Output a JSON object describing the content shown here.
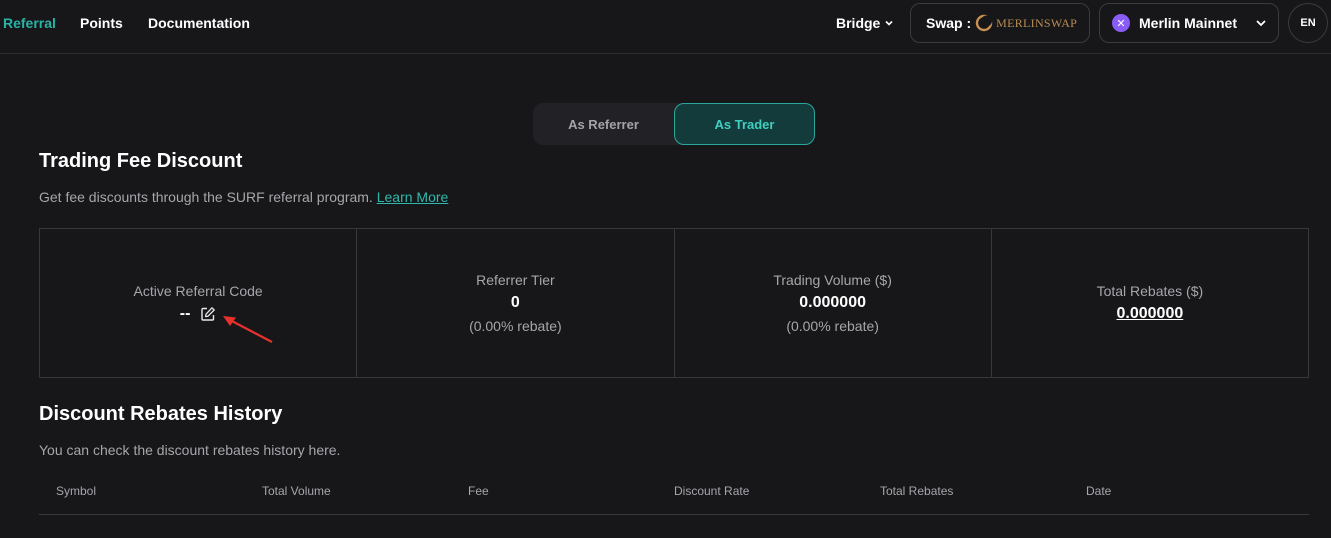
{
  "nav": {
    "links": [
      "Referral",
      "Points",
      "Documentation"
    ],
    "bridge_label": "Bridge",
    "swap_label": "Swap :",
    "swap_brand": "MERLINSWAP",
    "network_label": "Merlin Mainnet",
    "language": "EN"
  },
  "toggle": {
    "referrer": "As Referrer",
    "trader": "As Trader",
    "active": "As Trader"
  },
  "fee_section": {
    "title": "Trading Fee Discount",
    "description": "Get fee discounts through the SURF referral program.",
    "learn_more": "Learn More"
  },
  "stats": {
    "active_code": {
      "label": "Active Referral Code",
      "value": "--"
    },
    "tier": {
      "label": "Referrer Tier",
      "value": "0",
      "sub": "(0.00% rebate)"
    },
    "volume": {
      "label": "Trading Volume ($)",
      "value": "0.000000",
      "sub": "(0.00% rebate)"
    },
    "rebates": {
      "label": "Total Rebates ($)",
      "value": "0.000000"
    }
  },
  "history_section": {
    "title": "Discount Rebates History",
    "description": "You can check the discount rebates history here.",
    "columns": [
      "Symbol",
      "Total Volume",
      "Fee",
      "Discount Rate",
      "Total Rebates",
      "Date"
    ]
  },
  "colors": {
    "accent": "#27b3a6",
    "background": "#17171a",
    "annotation_arrow": "#e8312a"
  },
  "icons": [
    "chevron-down-icon",
    "merlinswap-logo-icon",
    "merlin-chain-icon",
    "edit-icon",
    "annotation-arrow-icon"
  ]
}
